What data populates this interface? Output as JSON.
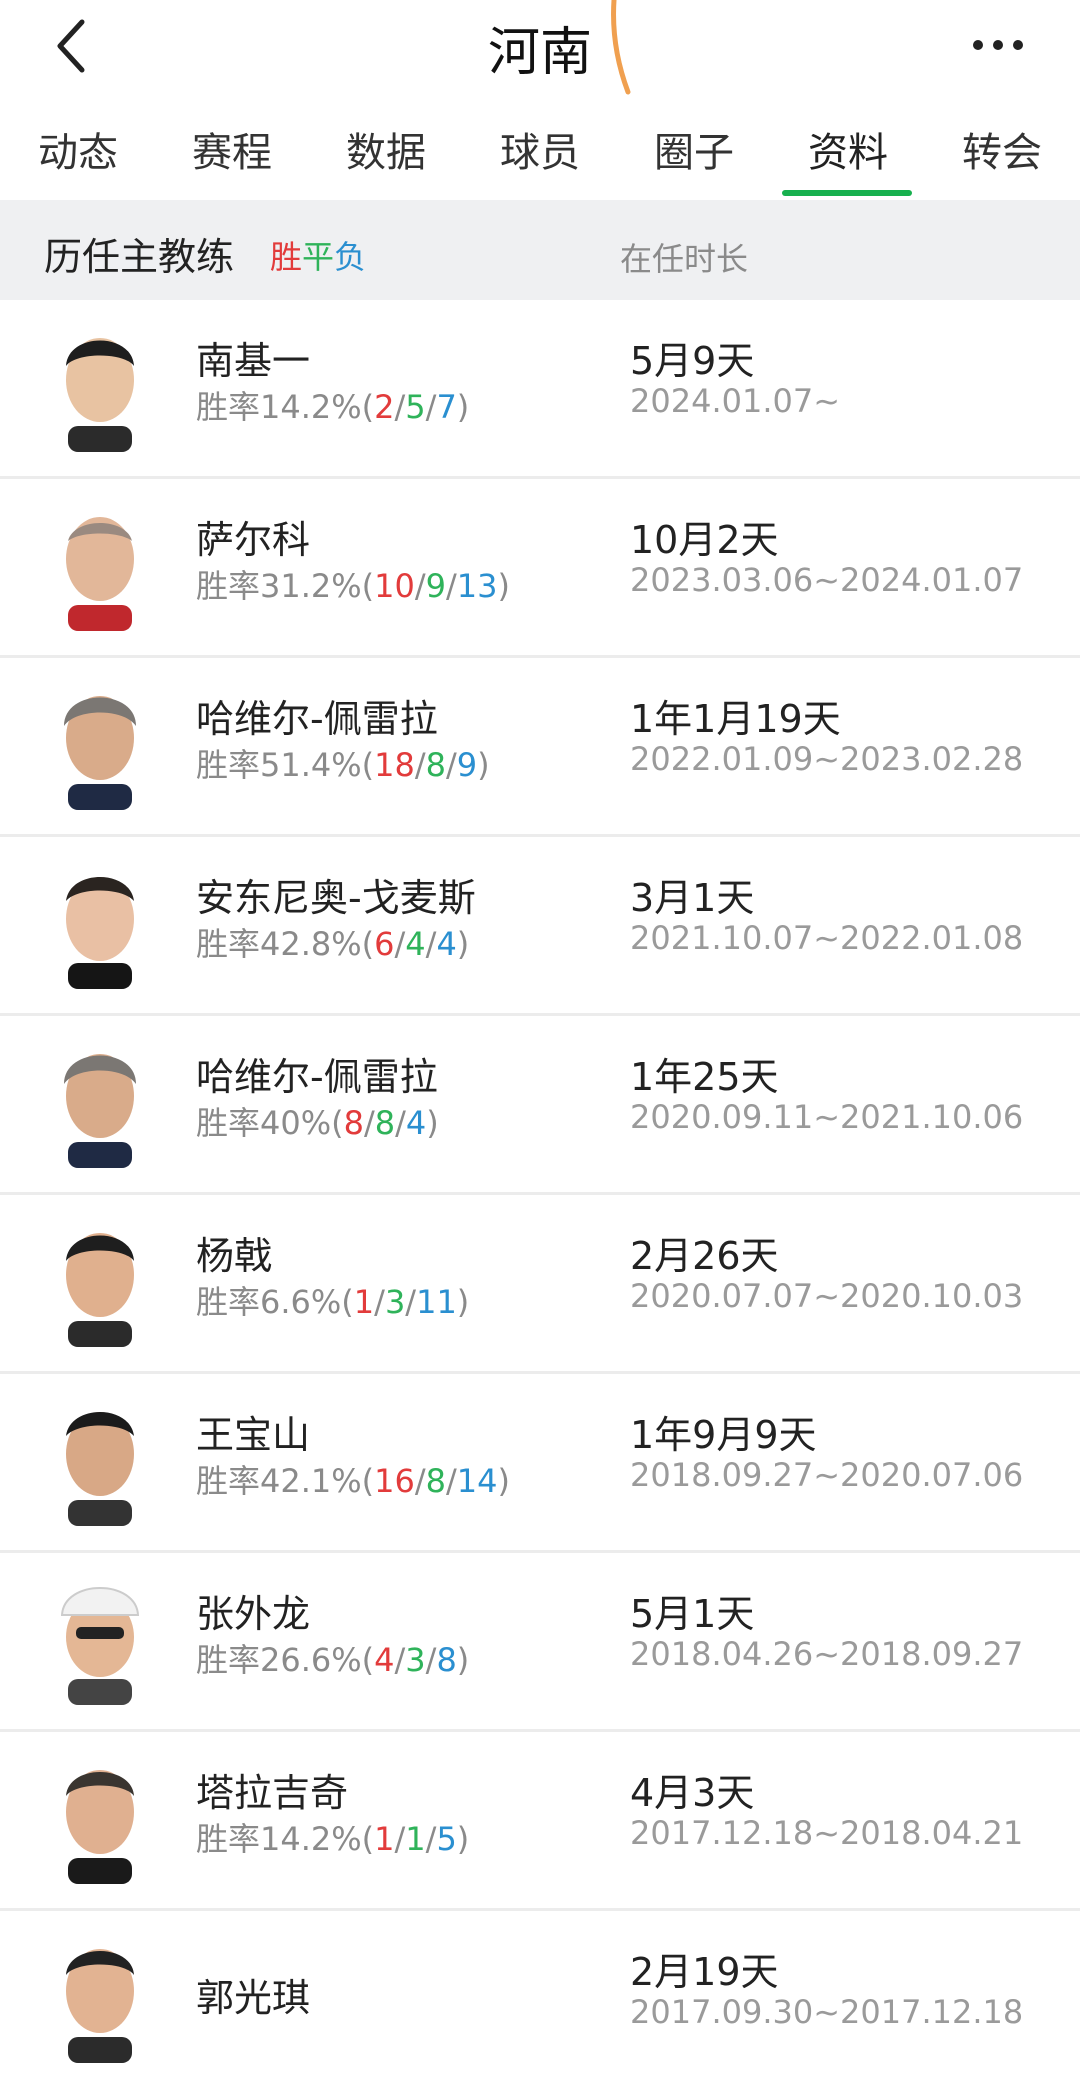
{
  "header": {
    "title": "河南"
  },
  "tabs": [
    {
      "label": "动态"
    },
    {
      "label": "赛程"
    },
    {
      "label": "数据"
    },
    {
      "label": "球员"
    },
    {
      "label": "圈子"
    },
    {
      "label": "资料"
    },
    {
      "label": "转会"
    }
  ],
  "active_tab": "资料",
  "section": {
    "title": "历任主教练",
    "legend_win": "胜",
    "legend_draw": "平",
    "legend_loss": "负",
    "tenure_label": "在任时长"
  },
  "coaches": [
    {
      "name": "南基一",
      "rate_prefix": "胜率14.2%(",
      "w": "2",
      "d": "5",
      "l": "7",
      "rate_suffix": ")",
      "tenure": "5月9天",
      "dates": "2024.01.07~"
    },
    {
      "name": "萨尔科",
      "rate_prefix": "胜率31.2%(",
      "w": "10",
      "d": "9",
      "l": "13",
      "rate_suffix": ")",
      "tenure": "10月2天",
      "dates": "2023.03.06~2024.01.07"
    },
    {
      "name": "哈维尔-佩雷拉",
      "rate_prefix": "胜率51.4%(",
      "w": "18",
      "d": "8",
      "l": "9",
      "rate_suffix": ")",
      "tenure": "1年1月19天",
      "dates": "2022.01.09~2023.02.28"
    },
    {
      "name": "安东尼奥-戈麦斯",
      "rate_prefix": "胜率42.8%(",
      "w": "6",
      "d": "4",
      "l": "4",
      "rate_suffix": ")",
      "tenure": "3月1天",
      "dates": "2021.10.07~2022.01.08"
    },
    {
      "name": "哈维尔-佩雷拉",
      "rate_prefix": "胜率40%(",
      "w": "8",
      "d": "8",
      "l": "4",
      "rate_suffix": ")",
      "tenure": "1年25天",
      "dates": "2020.09.11~2021.10.06"
    },
    {
      "name": "杨戟",
      "rate_prefix": "胜率6.6%(",
      "w": "1",
      "d": "3",
      "l": "11",
      "rate_suffix": ")",
      "tenure": "2月26天",
      "dates": "2020.07.07~2020.10.03"
    },
    {
      "name": "王宝山",
      "rate_prefix": "胜率42.1%(",
      "w": "16",
      "d": "8",
      "l": "14",
      "rate_suffix": ")",
      "tenure": "1年9月9天",
      "dates": "2018.09.27~2020.07.06"
    },
    {
      "name": "张外龙",
      "rate_prefix": "胜率26.6%(",
      "w": "4",
      "d": "3",
      "l": "8",
      "rate_suffix": ")",
      "tenure": "5月1天",
      "dates": "2018.04.26~2018.09.27"
    },
    {
      "name": "塔拉吉奇",
      "rate_prefix": "胜率14.2%(",
      "w": "1",
      "d": "1",
      "l": "5",
      "rate_suffix": ")",
      "tenure": "4月3天",
      "dates": "2017.12.18~2018.04.21"
    },
    {
      "name": "郭光琪",
      "rate_prefix": "",
      "w": "",
      "d": "",
      "l": "",
      "rate_suffix": "",
      "tenure": "2月19天",
      "dates": "2017.09.30~2017.12.18"
    }
  ],
  "icons": {
    "back": "chevron-left-icon",
    "more": "more-dots-icon",
    "avatar": "coach-avatar-icon"
  },
  "colors": {
    "accent": "#17b04e",
    "win": "#e23b3b",
    "draw": "#2fb35a",
    "loss": "#2a8fd0"
  }
}
